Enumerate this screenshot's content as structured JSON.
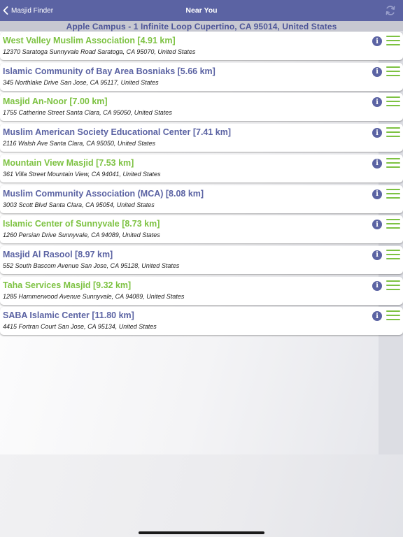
{
  "navbar": {
    "back_label": "Masjid Finder",
    "title": "Near You",
    "refresh_icon": "refresh-icon",
    "background_color": "#5b63a3"
  },
  "location": {
    "text": "Apple Campus - 1 Infinite Loop Cupertino, CA 95014, United States"
  },
  "colors": {
    "green": "#7dc242",
    "purple": "#5b63a3"
  },
  "masjids": [
    {
      "name": "West Valley Muslim Association [4.91 km]",
      "address": "12370 Saratoga Sunnyvale Road Saratoga, CA 95070, United States",
      "name_color": "#7dc242"
    },
    {
      "name": "Islamic Community of Bay Area Bosniaks [5.66 km]",
      "address": "345 Northlake Drive San Jose, CA 95117, United States",
      "name_color": "#5b63a3"
    },
    {
      "name": "Masjid An-Noor [7.00 km]",
      "address": "1755 Catherine Street Santa Clara, CA 95050, United States",
      "name_color": "#7dc242"
    },
    {
      "name": "Muslim American Society Educational Center [7.41 km]",
      "address": "2116 Walsh Ave Santa Clara, CA 95050, United States",
      "name_color": "#5b63a3"
    },
    {
      "name": "Mountain View Masjid [7.53 km]",
      "address": "361 Villa Street Mountain View, CA 94041, United States",
      "name_color": "#7dc242"
    },
    {
      "name": "Muslim Community Association (MCA) [8.08 km]",
      "address": "3003 Scott Blvd Santa Clara, CA 95054, United States",
      "name_color": "#5b63a3"
    },
    {
      "name": "Islamic Center of Sunnyvale [8.73 km]",
      "address": "1260 Persian Drive Sunnyvale, CA 94089, United States",
      "name_color": "#7dc242"
    },
    {
      "name": "Masjid Al Rasool [8.97 km]",
      "address": "552 South Bascom Avenue San Jose, CA 95128, United States",
      "name_color": "#5b63a3"
    },
    {
      "name": "Taha Services Masjid [9.32 km]",
      "address": "1285 Hammerwood Avenue Sunnyvale, CA 94089, United States",
      "name_color": "#7dc242"
    },
    {
      "name": "SABA Islamic Center [11.80 km]",
      "address": "4415 Fortran Court San Jose, CA 95134, United States",
      "name_color": "#5b63a3"
    }
  ],
  "row_icons": {
    "info": "info-icon",
    "menu": "hamburger-menu-icon",
    "info_glyph": "i"
  }
}
